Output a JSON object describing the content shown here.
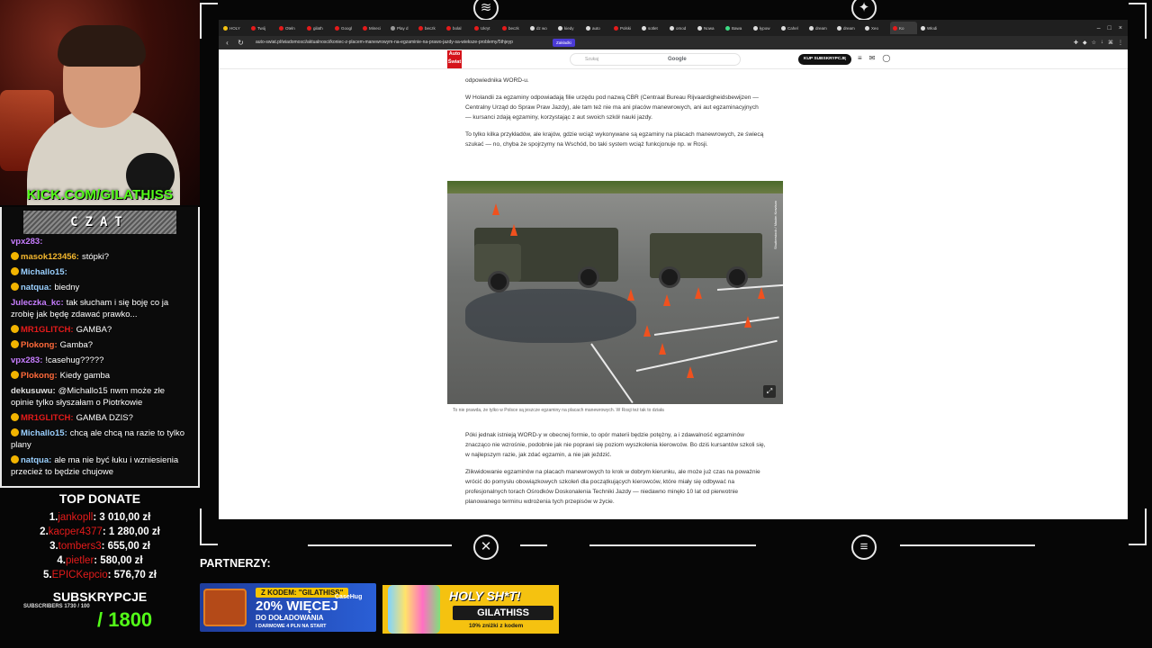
{
  "overlay": {
    "kick_url": "KICK.COM/GILATHISS",
    "chat_title": "CZAT",
    "partners_label": "PARTNERZY:"
  },
  "chat": {
    "messages": [
      {
        "user": "vpx283:",
        "text": "",
        "color": "#c77dff"
      },
      {
        "user": "masok123456:",
        "text": "stópki?",
        "color": "#f5b82e"
      },
      {
        "user": "Michallo15:",
        "text": "",
        "color": "#9ad0ff"
      },
      {
        "user": "natqua:",
        "text": "biedny",
        "color": "#9ad0ff"
      },
      {
        "user": "Juleczka_kc:",
        "text": "tak słucham i się boję co ja zrobię jak będę zdawać prawko...",
        "color": "#c77dff"
      },
      {
        "user": "MR1GLITCH:",
        "text": "GAMBA?",
        "color": "#e51b1b"
      },
      {
        "user": "Plokong:",
        "text": "Gamba?",
        "color": "#ff6a3a"
      },
      {
        "user": "vpx283:",
        "text": "!casehug?????",
        "color": "#c77dff"
      },
      {
        "user": "Plokong:",
        "text": "Kiedy gamba",
        "color": "#ff6a3a"
      },
      {
        "user": "dekusuwu:",
        "text": "@Michallo15 nwm może złe opinie tylko słyszałam o Piotrkowie",
        "color": "#e0e0e0"
      },
      {
        "user": "MR1GLITCH:",
        "text": "GAMBA DZIS?",
        "color": "#e51b1b"
      },
      {
        "user": "Michallo15:",
        "text": "chcą ale chcą na razie to tylko plany",
        "color": "#9ad0ff"
      },
      {
        "user": "natqua:",
        "text": "ale ma nie być łuku i wzniesienia przecież to będzie chujowe",
        "color": "#9ad0ff"
      }
    ]
  },
  "donates": {
    "title": "TOP DONATE",
    "rows": [
      {
        "rank": "1.",
        "name": "jankopll",
        "amount": ": 3 010,00 zł"
      },
      {
        "rank": "2.",
        "name": "kacper4377",
        "amount": ": 1 280,00 zł"
      },
      {
        "rank": "3.",
        "name": "tombers3",
        "amount": ": 655,00 zł"
      },
      {
        "rank": "4.",
        "name": "pietler",
        "amount": ": 580,00 zł"
      },
      {
        "rank": "5.",
        "name": "EPICKepcio",
        "amount": ": 576,70 zł"
      }
    ]
  },
  "subs": {
    "title": "SUBSKRYPCJE",
    "small": "SUBSCRIBERS 1730 / 100",
    "goal": "/ 1800"
  },
  "ads": {
    "case_code": "Z KODEM: \"GILATHISS\"",
    "case_brand": "CaseHug",
    "case_big": "20% WIĘCEJ",
    "case_mid": "DO DOŁADOWANIA",
    "case_small": "I DARMOWE 4 PLN NA START",
    "holy_title": "HOLY SH*T!",
    "holy_badge": "GILATHISS",
    "holy_small": "10% zniżki z kodem"
  },
  "browser": {
    "tabs": [
      {
        "label": "HOLY",
        "color": "#f5c210"
      },
      {
        "label": "Twój",
        "color": "#e51b1b"
      },
      {
        "label": "Oteln",
        "color": "#e51b1b"
      },
      {
        "label": "gilath",
        "color": "#e51b1b"
      },
      {
        "label": "Googl",
        "color": "#e51b1b"
      },
      {
        "label": "Mineci",
        "color": "#e51b1b"
      },
      {
        "label": "Play d",
        "color": "#999999"
      },
      {
        "label": "beczk",
        "color": "#e51b1b"
      },
      {
        "label": "bolal",
        "color": "#e51b1b"
      },
      {
        "label": "Ukryt",
        "color": "#e51b1b"
      },
      {
        "label": "beczk",
        "color": "#e51b1b"
      },
      {
        "label": "dz wo",
        "color": "#dddddd"
      },
      {
        "label": "kiedy",
        "color": "#dddddd"
      },
      {
        "label": "auto",
        "color": "#dddddd"
      },
      {
        "label": "Polski",
        "color": "#e51b1b"
      },
      {
        "label": "sotlet",
        "color": "#dddddd"
      },
      {
        "label": "omod",
        "color": "#dddddd"
      },
      {
        "label": "Nowa",
        "color": "#dddddd"
      },
      {
        "label": "Bawa",
        "color": "#3ddc84"
      },
      {
        "label": "łypow",
        "color": "#dddddd"
      },
      {
        "label": "Cahel",
        "color": "#dddddd"
      },
      {
        "label": "dream",
        "color": "#dddddd"
      },
      {
        "label": "dream",
        "color": "#dddddd"
      },
      {
        "label": "Xeo",
        "color": "#dddddd"
      },
      {
        "label": "Ko",
        "color": "#e51b1b"
      },
      {
        "label": "Włodi",
        "color": "#dddddd"
      }
    ],
    "url": "auto-swiat.pl/wiadomosci/aktualnosci/koniec-z-placem-manewrowym-na-egzaminie-na-prawo-jazdy-sa-wieksze-problemy/5thjeyp",
    "chip_label": "Zakładki"
  },
  "site": {
    "logo": "Auto Świat",
    "search_placeholder": "Szukaj",
    "search_engine": "Google",
    "subscribe_label": "KUP SUBSKRYPCJĘ"
  },
  "article": {
    "p0": "odpowiednika WORD-u.",
    "p1": "W Holandii za egzaminy odpowiadają filie urzędu pod nazwą CBR (Centraal Bureau Rijvaardigheidsbewijzen — Centralny Urząd do Spraw Praw Jazdy), ale tam też nie ma ani placów manewrowych, ani aut egzaminacyjnych — kursanci zdają egzaminy, korzystając z aut swoich szkół nauki jazdy.",
    "p2": "To tylko kilka przykładów, ale krajów, gdzie wciąż wykonywane są egzaminy na placach manewrowych, ze świecą szukać — no, chyba że spojrzymy na Wschód, bo taki system wciąż funkcjonuje np. w Rosji.",
    "photo_credit": "Shutterstock / Maxim Kravtsov",
    "caption": "To nie prawda, że tylko w Polsce są jeszcze egzaminy na placach manewrowych. W Rosji też tak to działa",
    "p3": "Póki jednak istnieją WORD-y w obecnej formie, to opór materii będzie potężny, a i zdawalność egzaminów znacząco nie wzrośnie, podobnie jak nie poprawi się poziom wyszkolenia kierowców. Bo dziś kursantów szkoli się, w najlepszym razie, jak zdać egzamin, a nie jak jeździć.",
    "p4": "Zlikwidowanie egzaminów na placach manewrowych to krok w dobrym kierunku, ale może już czas na poważnie wrócić do pomysłu obowiązkowych szkoleń dla początkujących kierowców, które miały się odbywać na profesjonalnych torach Ośrodków Doskonalenia Techniki Jazdy — niedawno minęło 10 lat od pierwotnie planowanego terminu wdrożenia tych przepisów w życie."
  }
}
